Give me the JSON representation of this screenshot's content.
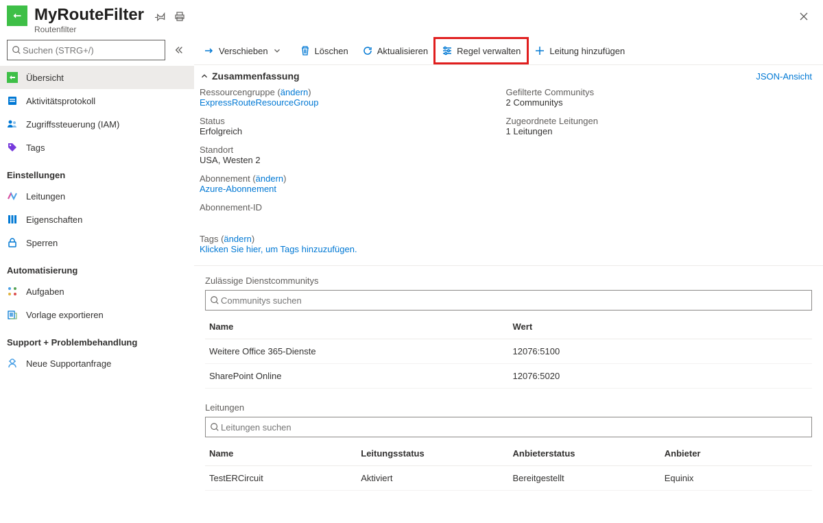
{
  "header": {
    "title": "MyRouteFilter",
    "subtitle": "Routenfilter"
  },
  "sidebar": {
    "search_placeholder": "Suchen (STRG+/)",
    "items_top": [
      {
        "label": "Übersicht"
      },
      {
        "label": "Aktivitätsprotokoll"
      },
      {
        "label": "Zugriffssteuerung (IAM)"
      },
      {
        "label": "Tags"
      }
    ],
    "group_settings": "Einstellungen",
    "items_settings": [
      {
        "label": "Leitungen"
      },
      {
        "label": "Eigenschaften"
      },
      {
        "label": "Sperren"
      }
    ],
    "group_automation": "Automatisierung",
    "items_automation": [
      {
        "label": "Aufgaben"
      },
      {
        "label": "Vorlage exportieren"
      }
    ],
    "group_support": "Support + Problembehandlung",
    "items_support": [
      {
        "label": "Neue Supportanfrage"
      }
    ]
  },
  "toolbar": {
    "move": "Verschieben",
    "delete": "Löschen",
    "refresh": "Aktualisieren",
    "manage_rule": "Regel verwalten",
    "add_circuit": "Leitung hinzufügen"
  },
  "summary": {
    "title": "Zusammenfassung",
    "json_view": "JSON-Ansicht",
    "resource_group_label": "Ressourcengruppe (",
    "change": "ändern",
    "paren_close": ")",
    "resource_group_value": "ExpressRouteResourceGroup",
    "status_label": "Status",
    "status_value": "Erfolgreich",
    "location_label": "Standort",
    "location_value": "USA, Westen 2",
    "subscription_label": "Abonnement (",
    "subscription_value": "Azure-Abonnement",
    "subscription_id_label": "Abonnement-ID",
    "filtered_label": "Gefilterte Communitys",
    "filtered_value": "2 Communitys",
    "circuits_label": "Zugeordnete Leitungen",
    "circuits_value": "1 Leitungen",
    "tags_label": "Tags (",
    "tags_action": "Klicken Sie hier, um Tags hinzuzufügen."
  },
  "communities": {
    "section": "Zulässige Dienstcommunitys",
    "search_placeholder": "Communitys suchen",
    "col_name": "Name",
    "col_value": "Wert",
    "rows": [
      {
        "name": "Weitere Office 365-Dienste",
        "value": "12076:5100"
      },
      {
        "name": "SharePoint Online",
        "value": "12076:5020"
      }
    ]
  },
  "circuits": {
    "section": "Leitungen",
    "search_placeholder": "Leitungen suchen",
    "col_name": "Name",
    "col_status": "Leitungsstatus",
    "col_provider_status": "Anbieterstatus",
    "col_provider": "Anbieter",
    "rows": [
      {
        "name": "TestERCircuit",
        "status": "Aktiviert",
        "pstatus": "Bereitgestellt",
        "provider": "Equinix"
      }
    ]
  }
}
